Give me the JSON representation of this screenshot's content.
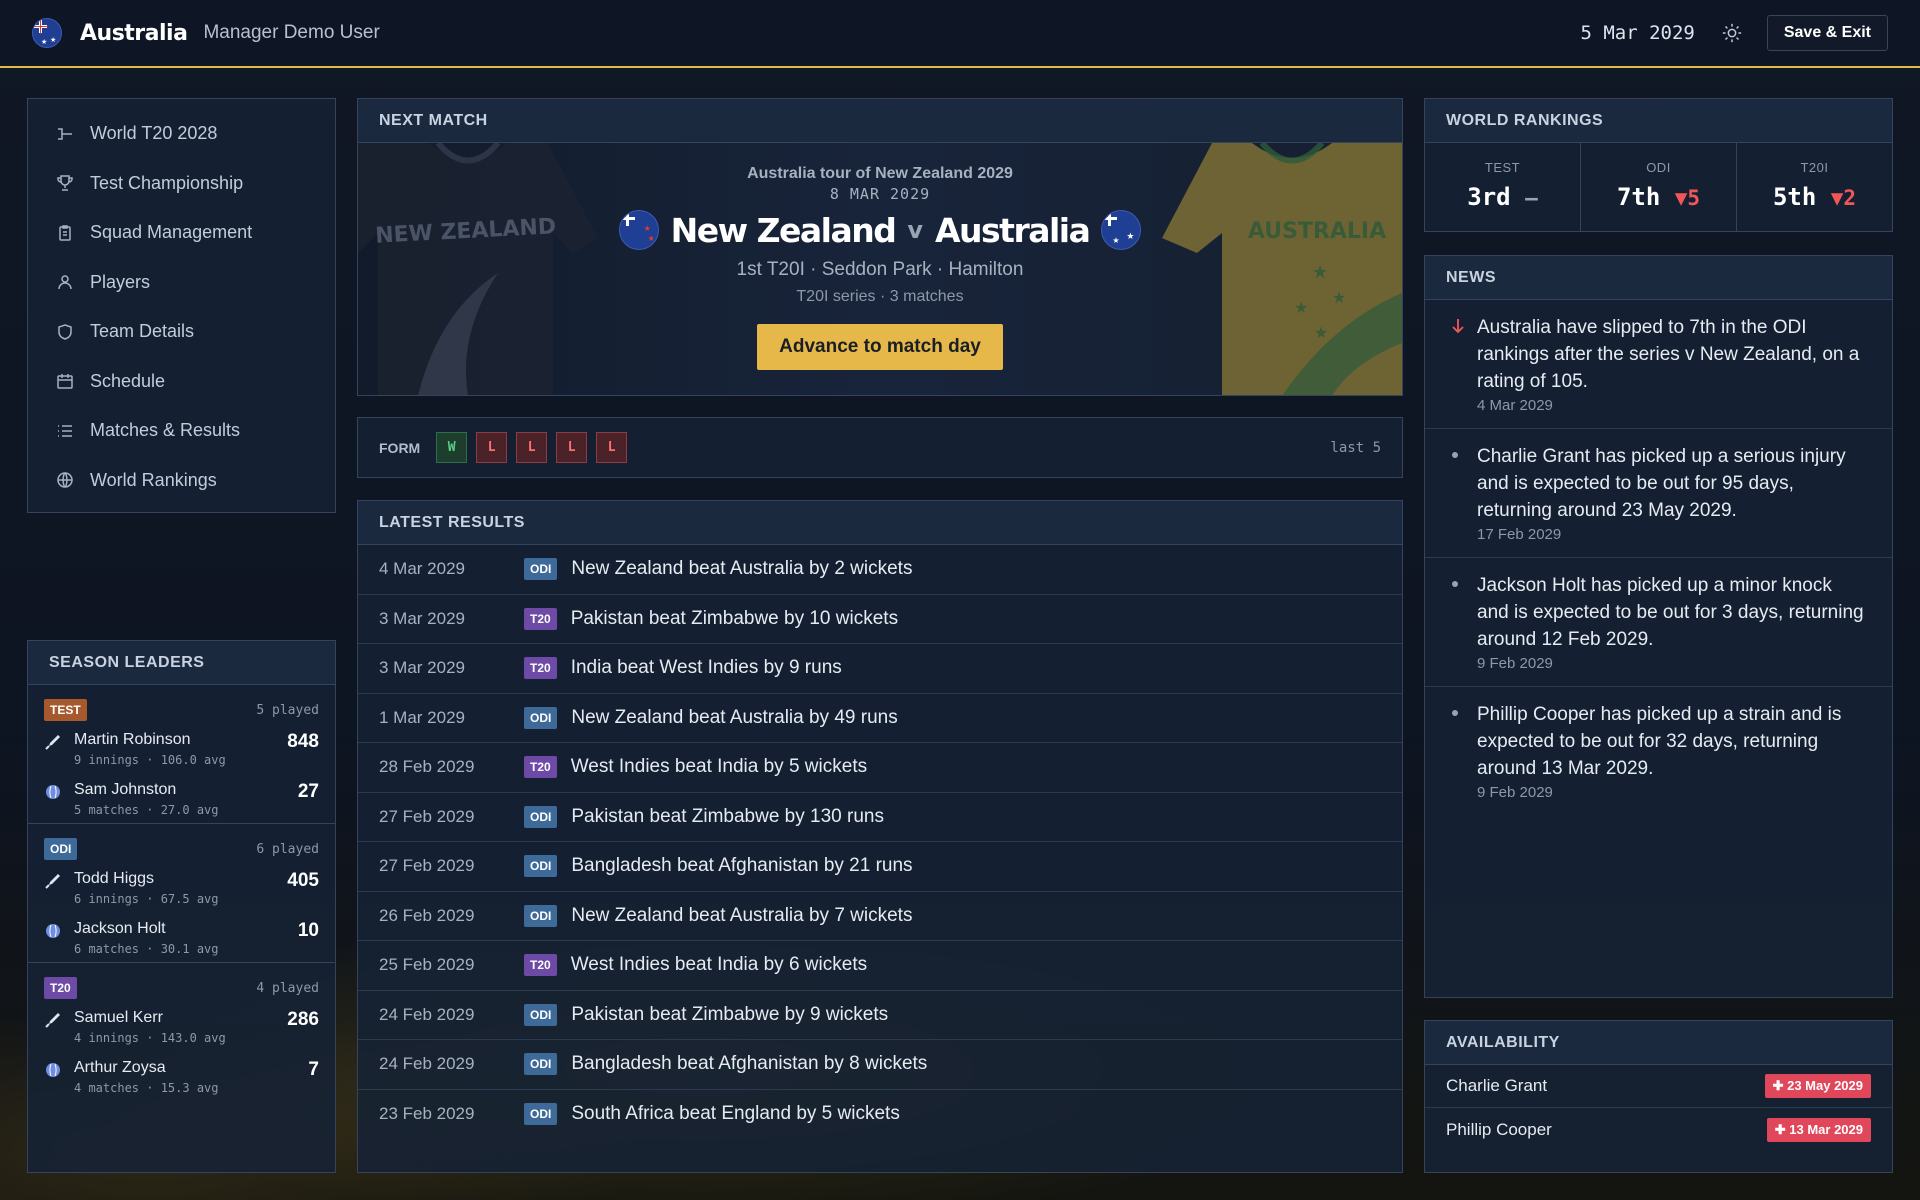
{
  "header": {
    "team": "Australia",
    "manager": "Manager Demo User",
    "date": "5 Mar 2029",
    "save_label": "Save & Exit"
  },
  "nav": {
    "items": [
      {
        "label": "World T20 2028",
        "icon": "bracket-icon"
      },
      {
        "label": "Test Championship",
        "icon": "trophy-icon"
      },
      {
        "label": "Squad Management",
        "icon": "clipboard-icon"
      },
      {
        "label": "Players",
        "icon": "user-icon"
      },
      {
        "label": "Team Details",
        "icon": "shield-icon"
      },
      {
        "label": "Schedule",
        "icon": "calendar-icon"
      },
      {
        "label": "Matches & Results",
        "icon": "list-icon"
      },
      {
        "label": "World Rankings",
        "icon": "globe-icon"
      }
    ]
  },
  "leaders": {
    "title": "SEASON LEADERS",
    "sections": [
      {
        "format": "TEST",
        "played": "5 played",
        "bat": {
          "name": "Martin Robinson",
          "sub": "9 innings · 106.0 avg",
          "value": "848"
        },
        "bowl": {
          "name": "Sam Johnston",
          "sub": "5 matches · 27.0 avg",
          "value": "27"
        }
      },
      {
        "format": "ODI",
        "played": "6 played",
        "bat": {
          "name": "Todd Higgs",
          "sub": "6 innings · 67.5 avg",
          "value": "405"
        },
        "bowl": {
          "name": "Jackson Holt",
          "sub": "6 matches · 30.1 avg",
          "value": "10"
        }
      },
      {
        "format": "T20",
        "played": "4 played",
        "bat": {
          "name": "Samuel Kerr",
          "sub": "4 innings · 143.0 avg",
          "value": "286"
        },
        "bowl": {
          "name": "Arthur Zoysa",
          "sub": "4 matches · 15.3 avg",
          "value": "7"
        }
      }
    ]
  },
  "next_match": {
    "title": "NEXT MATCH",
    "tour": "Australia tour of New Zealand 2029",
    "date": "8 MAR 2029",
    "home": "New Zealand",
    "vs": "v",
    "away": "Australia",
    "venue": "1st T20I · Seddon Park · Hamilton",
    "series": "T20I series · 3 matches",
    "advance_label": "Advance to match day",
    "home_jersey_text": "NEW ZEALAND",
    "away_jersey_text": "AUSTRALIA"
  },
  "form": {
    "label": "FORM",
    "results": [
      "W",
      "L",
      "L",
      "L",
      "L"
    ],
    "last_label": "last 5"
  },
  "latest": {
    "title": "LATEST RESULTS",
    "rows": [
      {
        "date": "4 Mar 2029",
        "fmt": "ODI",
        "text": "New Zealand beat Australia by 2 wickets"
      },
      {
        "date": "3 Mar 2029",
        "fmt": "T20",
        "text": "Pakistan beat Zimbabwe by 10 wickets"
      },
      {
        "date": "3 Mar 2029",
        "fmt": "T20",
        "text": "India beat West Indies by 9 runs"
      },
      {
        "date": "1 Mar 2029",
        "fmt": "ODI",
        "text": "New Zealand beat Australia by 49 runs"
      },
      {
        "date": "28 Feb 2029",
        "fmt": "T20",
        "text": "West Indies beat India by 5 wickets"
      },
      {
        "date": "27 Feb 2029",
        "fmt": "ODI",
        "text": "Pakistan beat Zimbabwe by 130 runs"
      },
      {
        "date": "27 Feb 2029",
        "fmt": "ODI",
        "text": "Bangladesh beat Afghanistan by 21 runs"
      },
      {
        "date": "26 Feb 2029",
        "fmt": "ODI",
        "text": "New Zealand beat Australia by 7 wickets"
      },
      {
        "date": "25 Feb 2029",
        "fmt": "T20",
        "text": "West Indies beat India by 6 wickets"
      },
      {
        "date": "24 Feb 2029",
        "fmt": "ODI",
        "text": "Pakistan beat Zimbabwe by 9 wickets"
      },
      {
        "date": "24 Feb 2029",
        "fmt": "ODI",
        "text": "Bangladesh beat Afghanistan by 8 wickets"
      },
      {
        "date": "23 Feb 2029",
        "fmt": "ODI",
        "text": "South Africa beat England by 5 wickets"
      }
    ]
  },
  "rankings": {
    "title": "WORLD RANKINGS",
    "cols": [
      {
        "fmt": "TEST",
        "rank": "3rd",
        "change": "—",
        "trend": "flat"
      },
      {
        "fmt": "ODI",
        "rank": "7th",
        "change": "▼5",
        "trend": "down"
      },
      {
        "fmt": "T20I",
        "rank": "5th",
        "change": "▼2",
        "trend": "down"
      }
    ]
  },
  "news": {
    "title": "NEWS",
    "items": [
      {
        "text": "Australia have slipped to 7th in the ODI rankings after the series v New Zealand, on a rating of 105.",
        "date": "4 Mar 2029",
        "kind": "down-arrow"
      },
      {
        "text": "Charlie Grant has picked up a serious injury and is expected to be out for 95 days, returning around 23 May 2029.",
        "date": "17 Feb 2029",
        "kind": "dot"
      },
      {
        "text": "Jackson Holt has picked up a minor knock and is expected to be out for 3 days, returning around 12 Feb 2029.",
        "date": "9 Feb 2029",
        "kind": "dot"
      },
      {
        "text": "Phillip Cooper has picked up a strain and is expected to be out for 32 days, returning around 13 Mar 2029.",
        "date": "9 Feb 2029",
        "kind": "dot"
      }
    ]
  },
  "availability": {
    "title": "AVAILABILITY",
    "rows": [
      {
        "name": "Charlie Grant",
        "return": "✚ 23 May 2029"
      },
      {
        "name": "Phillip Cooper",
        "return": "✚ 13 Mar 2029"
      }
    ]
  },
  "colors": {
    "accent": "#e2b84a",
    "win": "#5dcf8b",
    "loss": "#ff7070",
    "injury": "#e0475a",
    "odi": "#3d6a98",
    "t20": "#6d4aa6",
    "test": "#a5592c"
  }
}
